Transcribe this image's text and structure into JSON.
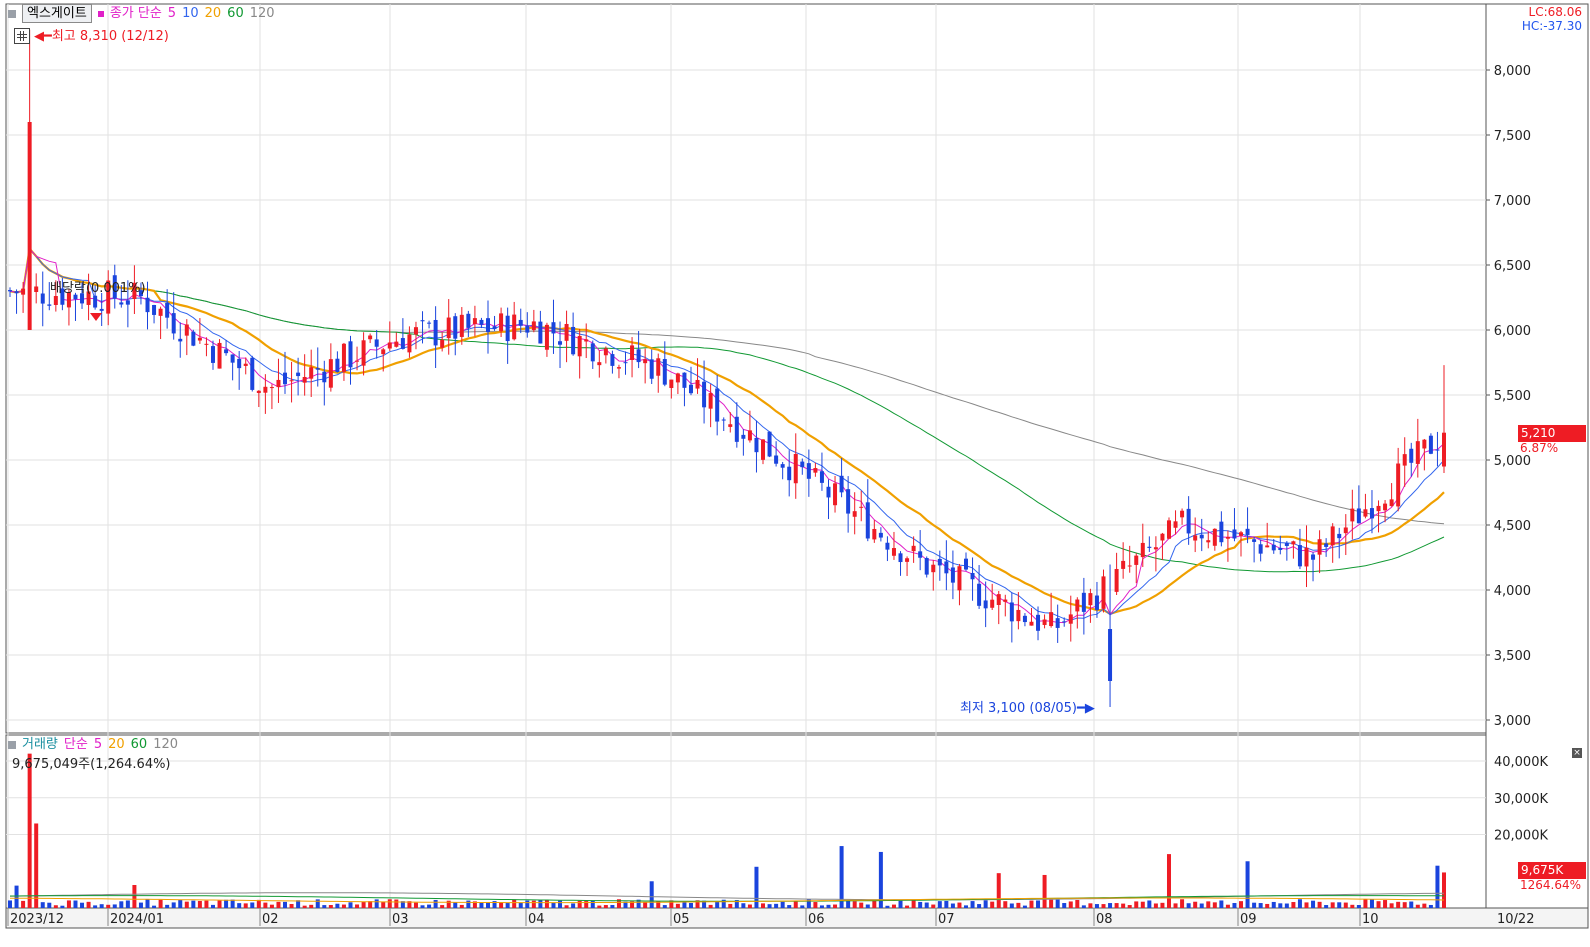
{
  "header": {
    "stock_name": "엑스게이트",
    "indicator": "종가 단순",
    "ma_periods": [
      {
        "label": "5",
        "color": "#e020c8"
      },
      {
        "label": "10",
        "color": "#3366ee"
      },
      {
        "label": "20",
        "color": "#f0a000"
      },
      {
        "label": "60",
        "color": "#119933"
      },
      {
        "label": "120",
        "color": "#888888"
      }
    ]
  },
  "corner": {
    "lc": "LC:68.06",
    "hc": "HC:-37.30",
    "lc_color": "#ee1c24",
    "hc_color": "#2255ee"
  },
  "annotations": {
    "high": "최고 8,310 (12/12)",
    "low": "최저 3,100 (08/05)",
    "dividend": "배당락(0.001%)"
  },
  "price_axis": [
    "8,000",
    "7,500",
    "7,000",
    "6,500",
    "6,000",
    "5,500",
    "5,000",
    "4,500",
    "4,000",
    "3,500",
    "3,000"
  ],
  "current_price": {
    "value": "5,210",
    "change": "6.87%"
  },
  "volume_header": {
    "label": "거래량",
    "indicator": "단순",
    "periods": [
      {
        "label": "5",
        "color": "#e020c8"
      },
      {
        "label": "20",
        "color": "#f0a000"
      },
      {
        "label": "60",
        "color": "#119933"
      },
      {
        "label": "120",
        "color": "#888888"
      }
    ],
    "value": "9,675,049주(1,264.64%)"
  },
  "volume_axis": [
    "40,000K",
    "30,000K",
    "20,000K"
  ],
  "current_volume": {
    "value": "9,675K",
    "ratio": "1264.64%"
  },
  "date_axis": [
    "2023/12",
    "2024/01",
    "02",
    "03",
    "04",
    "05",
    "06",
    "07",
    "08",
    "09",
    "10",
    "10/22"
  ],
  "colors": {
    "up": "#ee1c24",
    "down": "#1a44dd",
    "ma5": "#e020c8",
    "ma10": "#3366ee",
    "ma20": "#f0a000",
    "ma60": "#119933",
    "ma120": "#888888"
  },
  "chart_data": {
    "type": "candlestick",
    "ylim": [
      3000,
      8310
    ],
    "monthly_close_profile": [
      {
        "month": "2023/12",
        "close": 6300
      },
      {
        "month": "2024/01",
        "close": 6250
      },
      {
        "month": "02",
        "close": 5550
      },
      {
        "month": "03",
        "close": 5950
      },
      {
        "month": "04",
        "close": 6050
      },
      {
        "month": "05",
        "close": 5700
      },
      {
        "month": "06",
        "close": 4950
      },
      {
        "month": "07",
        "close": 4200
      },
      {
        "month": "08",
        "close": 3700
      },
      {
        "month": "09",
        "close": 4500
      },
      {
        "month": "10",
        "close": 4250
      },
      {
        "month": "10/22",
        "close": 5210
      }
    ],
    "high": 8310,
    "low": 3100,
    "last_close": 5210,
    "volume_peak_K": 42000,
    "last_volume_K": 9675
  }
}
